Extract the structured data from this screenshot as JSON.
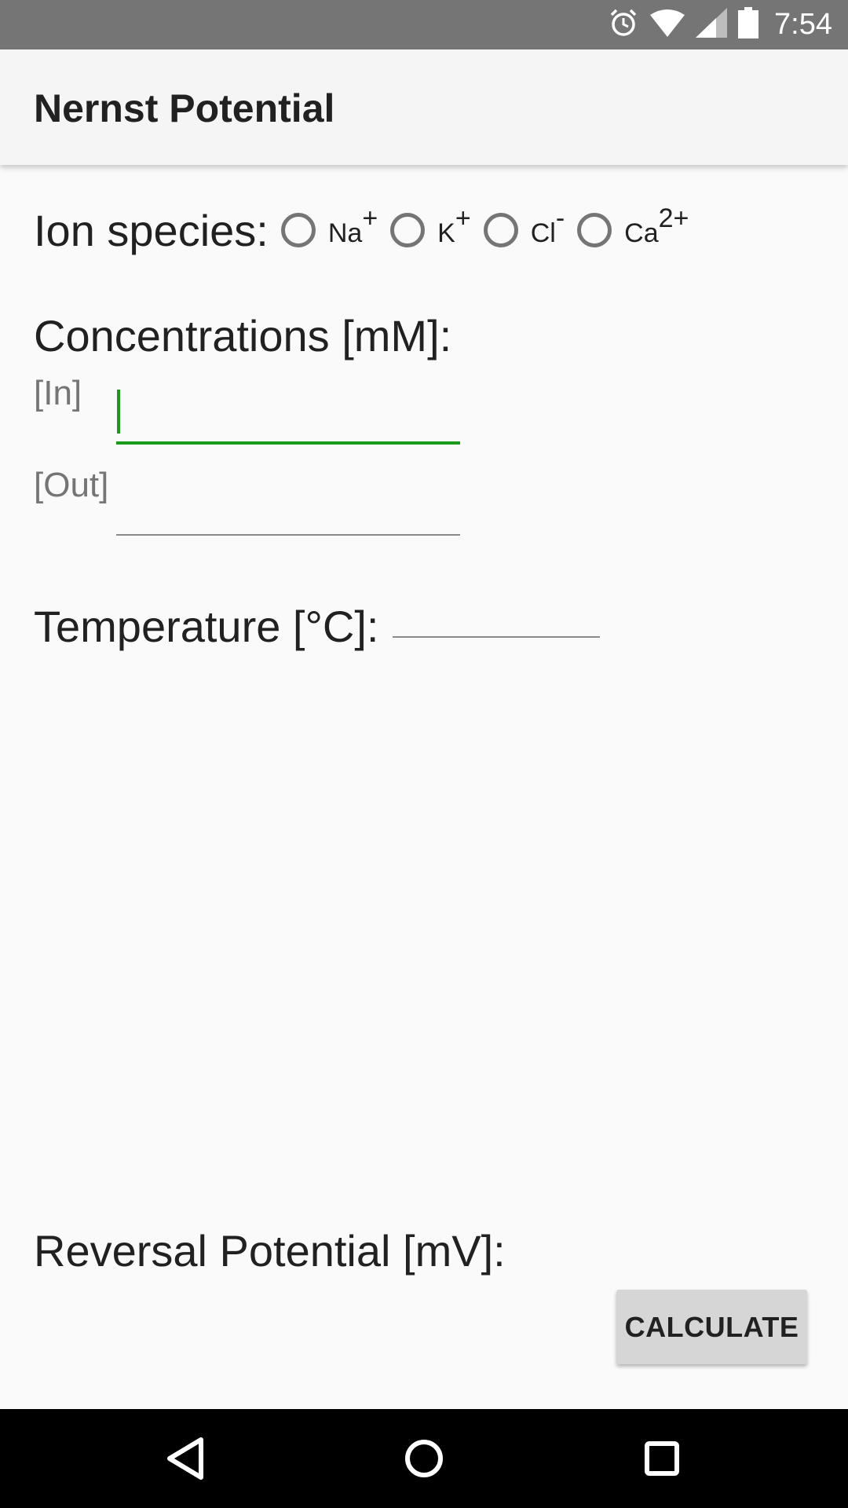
{
  "status_bar": {
    "time": "7:54",
    "icons": [
      "alarm-icon",
      "wifi-icon",
      "signal-icon",
      "battery-icon"
    ]
  },
  "app_bar": {
    "title": "Nernst Potential"
  },
  "ion_species": {
    "label": "Ion species:",
    "options": [
      {
        "base": "Na",
        "charge": "+",
        "selected": false
      },
      {
        "base": "K",
        "charge": "+",
        "selected": false
      },
      {
        "base": "Cl",
        "charge": "-",
        "selected": false
      },
      {
        "base": "Ca",
        "charge": "2+",
        "selected": false
      }
    ]
  },
  "concentrations": {
    "heading": "Concentrations [mM]:",
    "in_label": "[In]",
    "in_value": "",
    "out_label": "[Out]",
    "out_value": ""
  },
  "temperature": {
    "label": "Temperature [°C]:",
    "value": ""
  },
  "result": {
    "label": "Reversal Potential [mV]:"
  },
  "calculate_button": {
    "label": "CALCULATE"
  },
  "colors": {
    "status_bar": "#757575",
    "app_bar": "#f5f5f5",
    "background": "#fafafa",
    "focus_accent": "#1a9a1a",
    "button": "#d6d6d6",
    "nav_bar": "#000000"
  },
  "nav_bar": {
    "icons": [
      "back-icon",
      "home-icon",
      "recents-icon"
    ]
  }
}
